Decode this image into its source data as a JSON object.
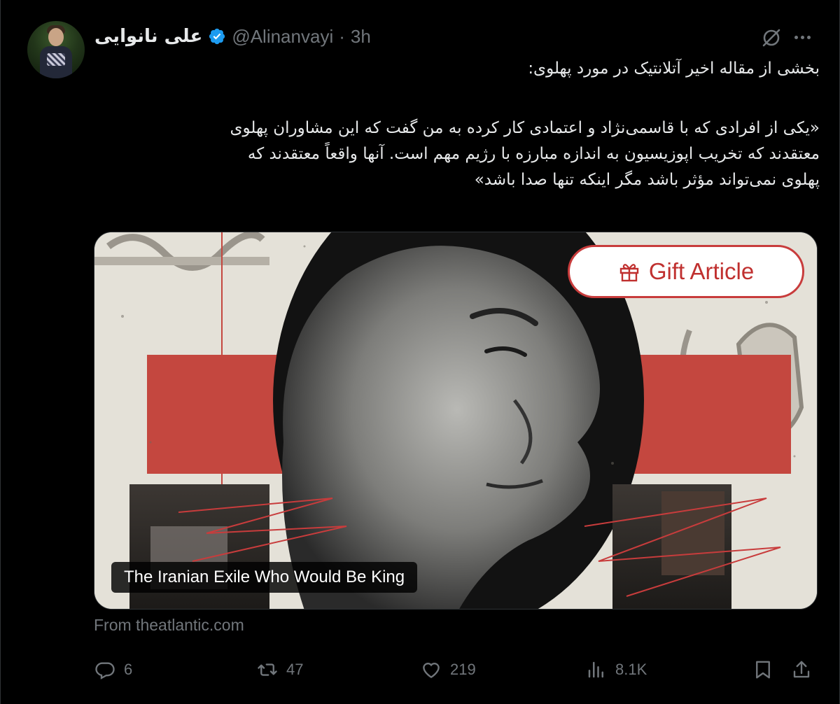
{
  "author": {
    "display_name": "علی نانوایی",
    "handle": "@Alinanvayi",
    "separator": "·",
    "time": "3h"
  },
  "tweet": {
    "lines": [
      "بخشی از مقاله اخیر آتلانتیک در مورد پهلوی:",
      "«یکی از افرادی که با قاسمی‌نژاد و اعتمادی کار کرده به من گفت که این مشاوران پهلوی",
      "معتقدند که تخریب اپوزیسیون به اندازه مبارزه با رژیم مهم است. آنها واقعاً معتقدند که",
      "پهلوی نمی‌تواند مؤثر باشد مگر اینکه تنها صدا باشد»"
    ]
  },
  "card": {
    "button_label": "Gift Article",
    "title": "The Iranian Exile Who Would Be King",
    "source": "From theatlantic.com"
  },
  "actions": {
    "replies": "6",
    "reposts": "47",
    "likes": "219",
    "views": "8.1K"
  },
  "colors": {
    "background": "#000000",
    "text": "#e7e9ea",
    "muted": "#71767b",
    "verified": "#1d9bf0",
    "gift_red": "#c83c3c"
  },
  "icons": [
    "verified-icon",
    "grok-icon",
    "more-icon",
    "gift-icon",
    "reply-icon",
    "repost-icon",
    "like-icon",
    "views-icon",
    "bookmark-icon",
    "share-icon"
  ]
}
